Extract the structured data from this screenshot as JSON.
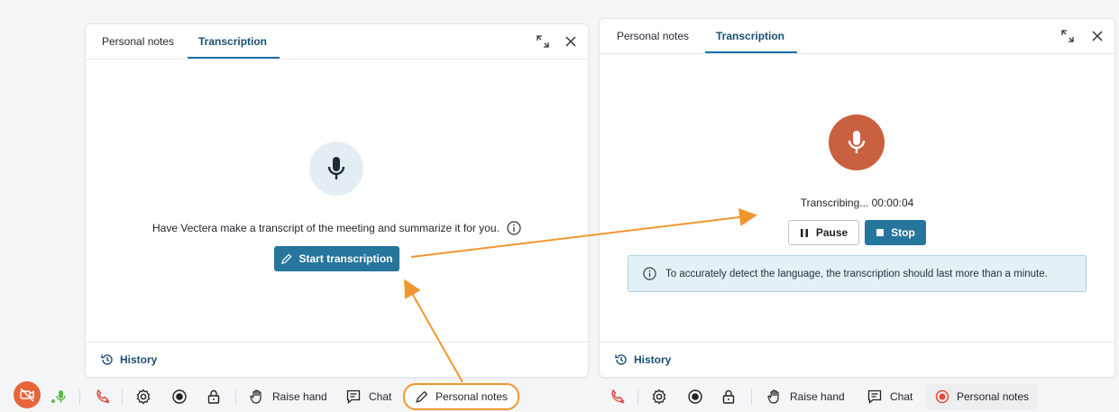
{
  "left_panel": {
    "tabs": [
      {
        "label": "Personal notes"
      },
      {
        "label": "Transcription"
      }
    ],
    "prompt_text": "Have Vectera make a transcript of the meeting and summarize it for you.",
    "start_button_label": "Start transcription",
    "history_label": "History"
  },
  "right_panel": {
    "tabs": [
      {
        "label": "Personal notes"
      },
      {
        "label": "Transcription"
      }
    ],
    "status_text": "Transcribing... 00:00:04",
    "pause_label": "Pause",
    "stop_label": "Stop",
    "info_text": "To accurately detect the language, the transcription should last more than a minute.",
    "history_label": "History"
  },
  "toolbar_left": {
    "raise_hand_label": "Raise hand",
    "chat_label": "Chat",
    "personal_notes_label": "Personal notes"
  },
  "toolbar_right": {
    "raise_hand_label": "Raise hand",
    "chat_label": "Chat",
    "personal_notes_label": "Personal notes"
  },
  "colors": {
    "accent": "#26759c",
    "recording": "#c9603f",
    "highlight": "#f0962e",
    "mic_active": "#5fb84a"
  }
}
